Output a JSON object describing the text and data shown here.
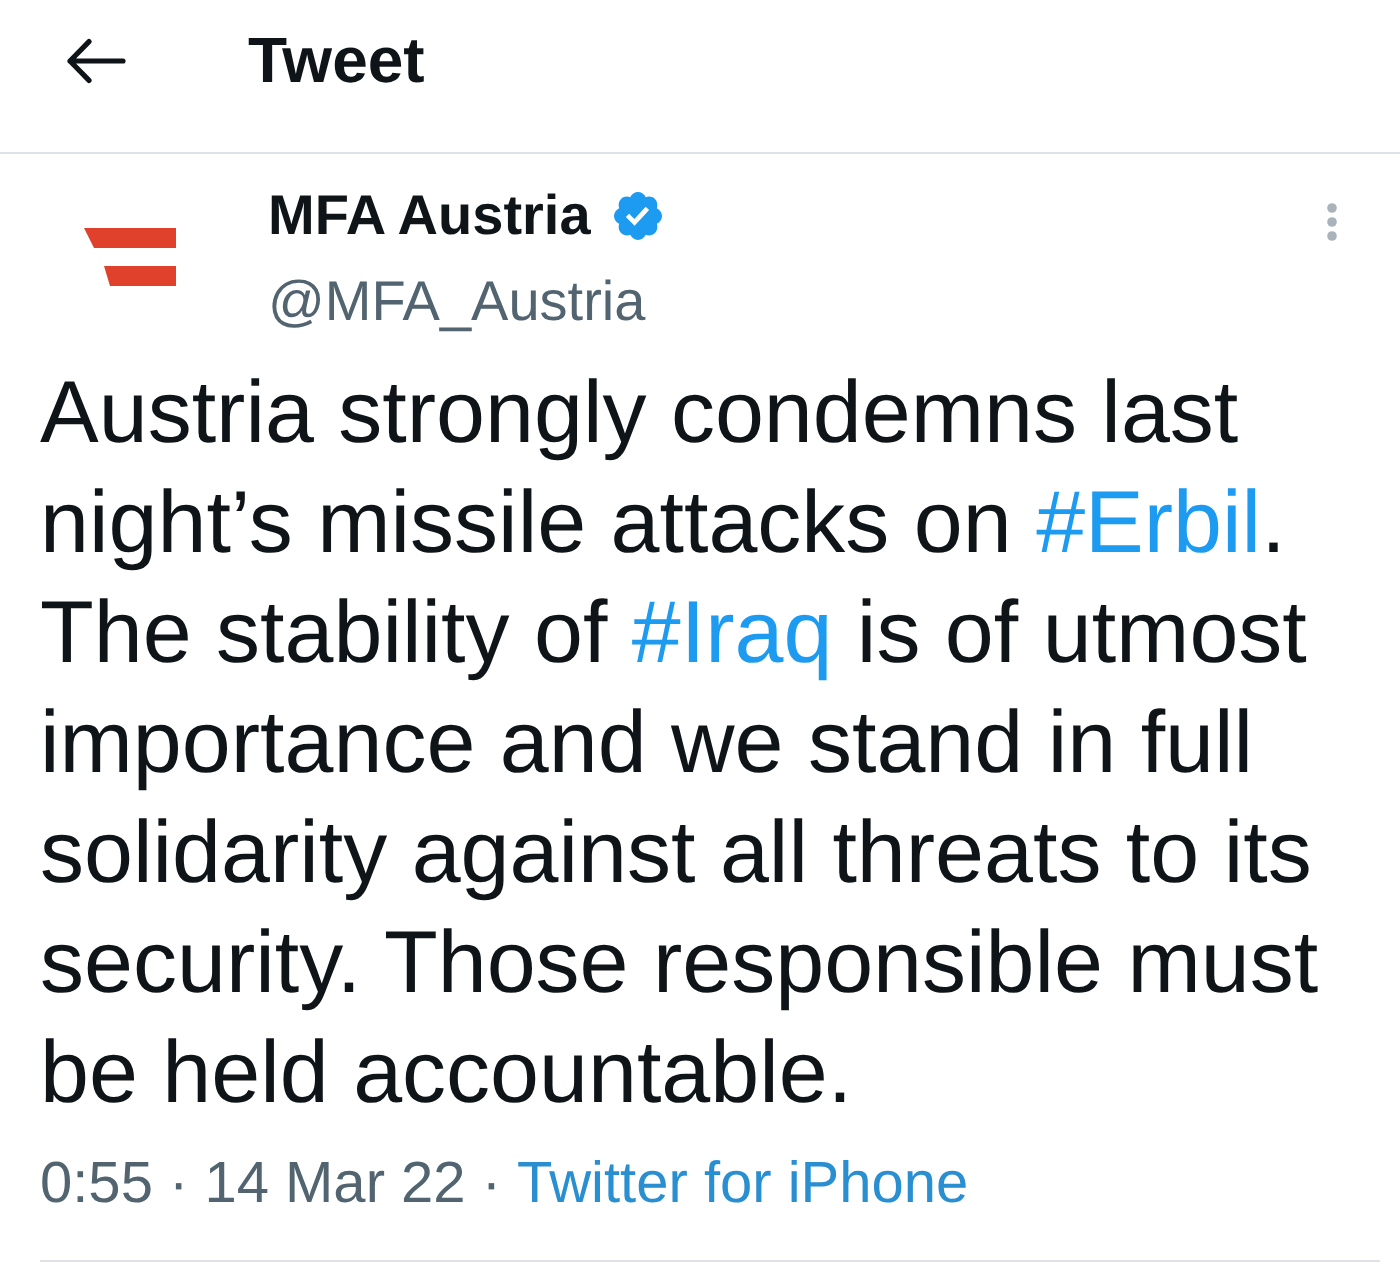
{
  "header": {
    "title": "Tweet"
  },
  "tweet": {
    "author": {
      "name": "MFA Austria",
      "verified": true,
      "handle": "@MFA_Austria"
    },
    "body": [
      {
        "kind": "text",
        "text": "Austria strongly condemns last night’s missile attacks on "
      },
      {
        "kind": "hashtag",
        "text": "#Erbil"
      },
      {
        "kind": "text",
        "text": ". The stability of "
      },
      {
        "kind": "hashtag",
        "text": "#Iraq"
      },
      {
        "kind": "text",
        "text": " is of utmost importance and we stand in full solidarity against all threats to its security. Those responsible must be held accountable."
      }
    ],
    "meta": {
      "timestamp": "0:55 · 14 Mar 22 ·",
      "source": "Twitter for iPhone"
    }
  }
}
